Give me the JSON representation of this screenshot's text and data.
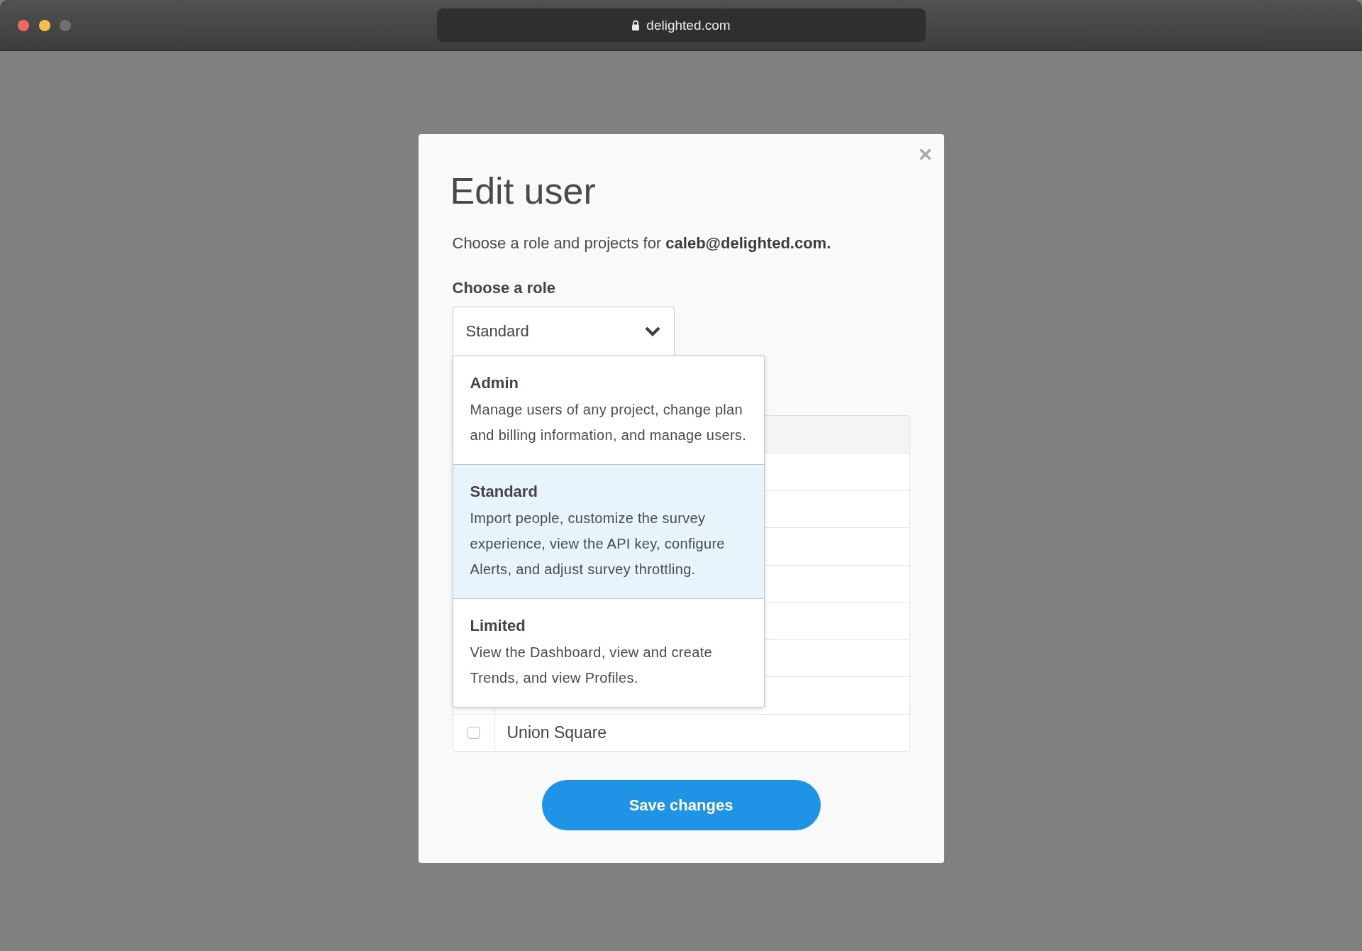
{
  "browser": {
    "url": "delighted.com"
  },
  "dialog": {
    "title": "Edit user",
    "intro": "Choose a role and projects for **caleb@delighted.com.**",
    "role_label": "Choose a role",
    "role_select": {
      "value": "Standard",
      "expanded": true
    },
    "role_options": [
      {
        "name": "Admin",
        "description": "Manage users of any project, change plan and billing information, and manage users.",
        "selected": false
      },
      {
        "name": "Standard",
        "description": "Import people, customize the survey experience, view the API key, configure Alerts, and adjust survey throttling.",
        "selected": true
      },
      {
        "name": "Limited",
        "description": "View the Dashboard, view and create Trends, and view Profiles.",
        "selected": false
      }
    ],
    "projects_table": {
      "rows": [
        {
          "covered": true
        },
        {
          "covered": true
        },
        {
          "covered": true
        },
        {
          "covered": true
        },
        {
          "covered": true
        },
        {
          "covered": true
        },
        {
          "covered": true
        },
        {
          "covered": false,
          "checked": false,
          "name": "Union Square"
        }
      ]
    },
    "save_button": {
      "label": "Save changes"
    }
  }
}
